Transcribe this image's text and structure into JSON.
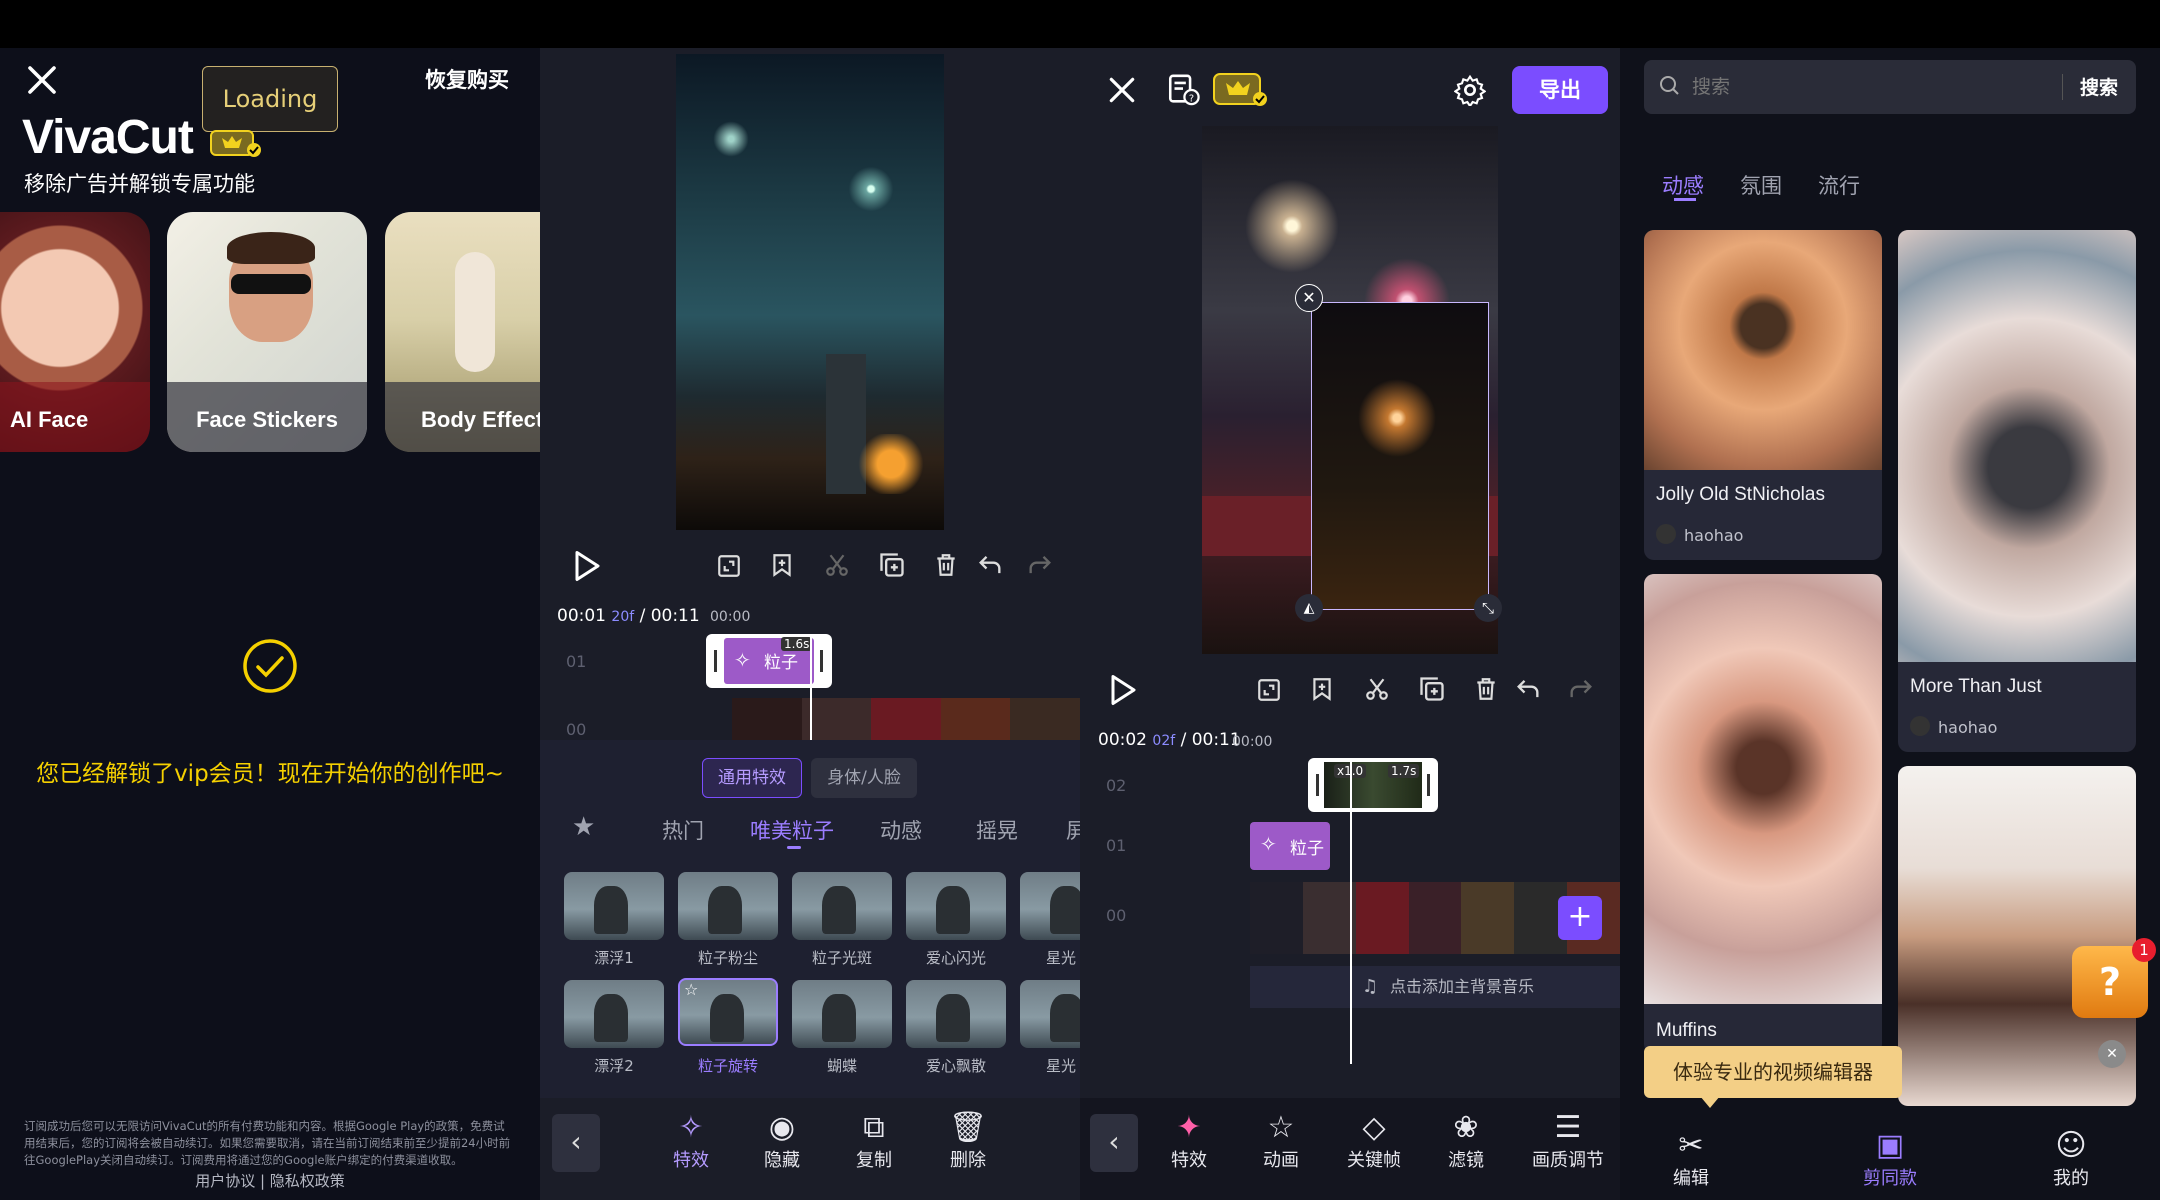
{
  "panel1": {
    "close_icon": "close-icon",
    "loading": "Loading",
    "restore": "恢复购买",
    "brand": "VivaCut",
    "subtitle": "移除广告并解锁专属功能",
    "features": [
      {
        "label": "AI Face"
      },
      {
        "label": "Face Stickers"
      },
      {
        "label": "Body Effect"
      }
    ],
    "success_text": "您已经解锁了vip会员！现在开始你的创作吧~",
    "fine_print": "订阅成功后您可以无限访问VivaCut的所有付费功能和内容。根据Google Play的政策，免费试用结束后，您的订阅将会被自动续订。如果您需要取消，请在当前订阅结束前至少提前24小时前往GooglePlay关闭自动续订。订阅费用将通过您的Google账户绑定的付费渠道收取。",
    "links": "用户协议 | 隐私权政策",
    "accent": "#f5d000"
  },
  "panel2": {
    "time_current": "00:01",
    "time_frame": "20f",
    "time_total": "/ 00:11",
    "ruler_start": "00:00",
    "track_labels": [
      "01",
      "00"
    ],
    "clip_label": "粒子",
    "clip_duration": "1.6s",
    "category_tabs": [
      {
        "label": "通用特效",
        "active": true
      },
      {
        "label": "身体/人脸",
        "active": false
      }
    ],
    "subtabs": [
      "热门",
      "唯美粒子",
      "动感",
      "摇晃",
      "屏"
    ],
    "active_subtab": "唯美粒子",
    "effects_row1": [
      "漂浮1",
      "粒子粉尘",
      "粒子光斑",
      "爱心闪光",
      "星光"
    ],
    "effects_row2": [
      "漂浮2",
      "粒子旋转",
      "蝴蝶",
      "爱心飘散",
      "星光"
    ],
    "selected_effect": "粒子旋转",
    "bottom_bar": [
      {
        "label": "特效",
        "icon": "sparkle-icon"
      },
      {
        "label": "隐藏",
        "icon": "eye-icon"
      },
      {
        "label": "复制",
        "icon": "copy-icon"
      },
      {
        "label": "删除",
        "icon": "trash-icon"
      }
    ]
  },
  "panel3": {
    "export_label": "导出",
    "time_current": "00:02",
    "time_frame": "02f",
    "time_total": "/ 00:11",
    "ruler_start": "00:00",
    "track_labels": [
      "02",
      "01",
      "00"
    ],
    "overlay_speed": "x1.0",
    "overlay_duration": "1.7s",
    "effect_label": "粒子",
    "music_hint": "点击添加主背景音乐",
    "bottom_bar": [
      {
        "label": "特效",
        "icon": "sparkle-icon"
      },
      {
        "label": "动画",
        "icon": "animation-icon"
      },
      {
        "label": "关键帧",
        "icon": "keyframe-icon"
      },
      {
        "label": "滤镜",
        "icon": "filter-icon"
      },
      {
        "label": "画质调节",
        "icon": "adjust-icon"
      }
    ],
    "accent": "#7b4dff"
  },
  "panel4": {
    "search_placeholder": "搜索",
    "search_button": "搜索",
    "tabs": [
      "动感",
      "氛围",
      "流行"
    ],
    "active_tab": "动感",
    "templates": [
      {
        "title": "Jolly Old StNicholas",
        "user": "haohao"
      },
      {
        "title": "More Than Just",
        "user": "haohao"
      },
      {
        "title": "Muffins",
        "user": ""
      }
    ],
    "promo_badge": "1",
    "tooltip": "体验专业的视频编辑器",
    "nav": [
      {
        "label": "编辑",
        "icon": "scissors-icon",
        "active": false
      },
      {
        "label": "剪同款",
        "icon": "template-icon",
        "active": true
      },
      {
        "label": "我的",
        "icon": "person-icon",
        "active": false
      }
    ]
  }
}
